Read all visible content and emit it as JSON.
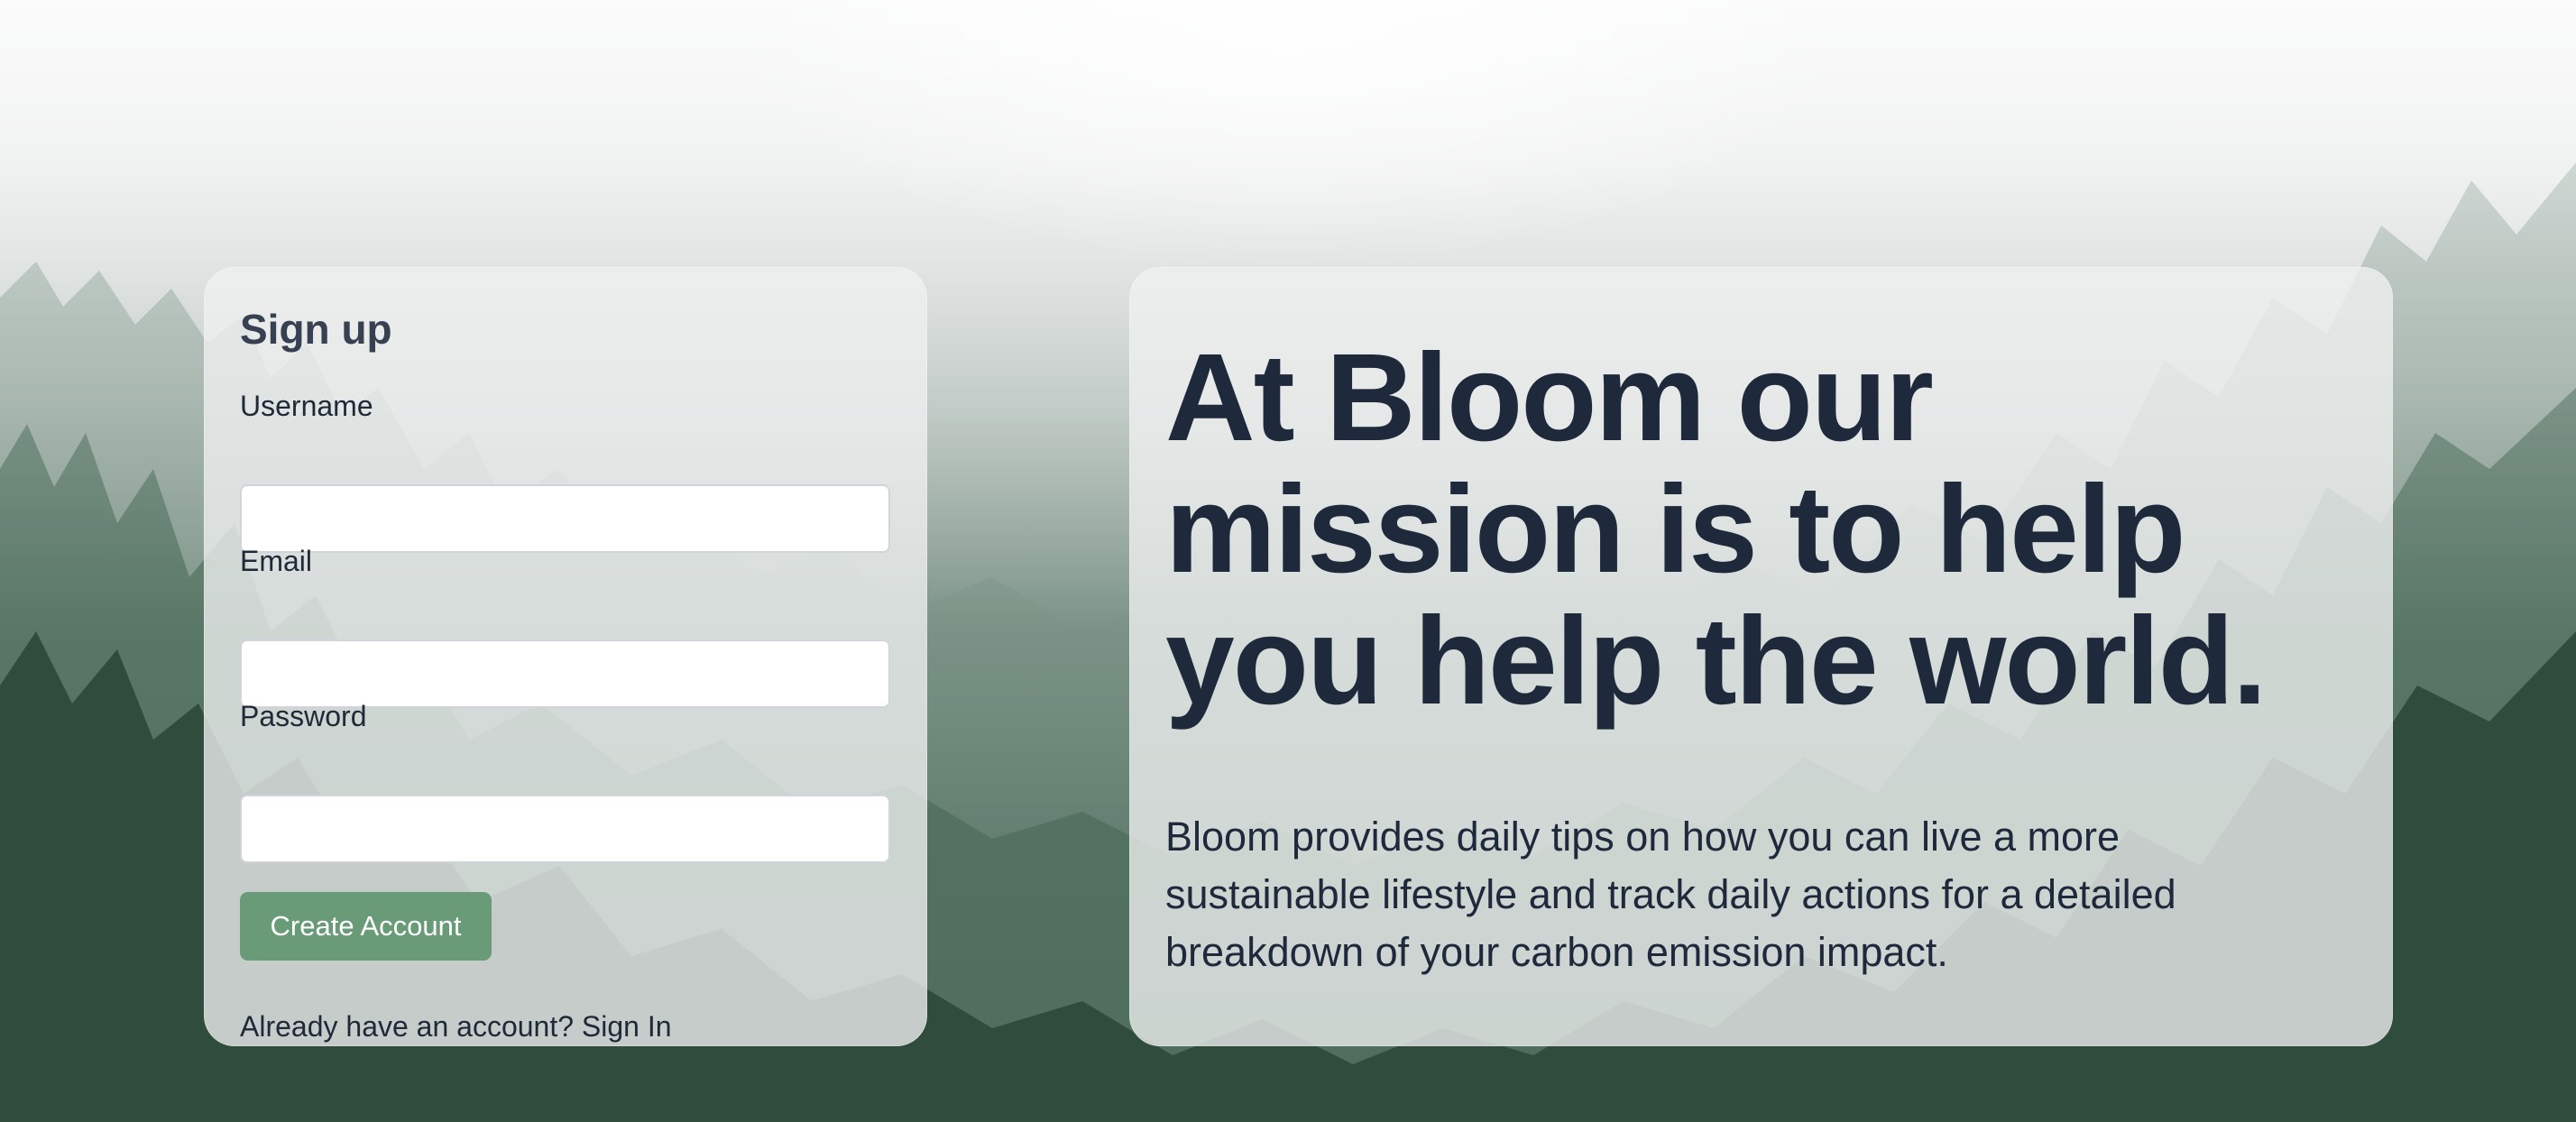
{
  "signup": {
    "title": "Sign up",
    "username_label": "Username",
    "username_value": "",
    "email_label": "Email",
    "email_value": "",
    "password_label": "Password",
    "password_value": "",
    "create_button_label": "Create Account",
    "have_account_text": "Already have an account?",
    "sign_in_label": "Sign In"
  },
  "mission": {
    "heading": "At Bloom our mission is to help you help the world.",
    "description": "Bloom provides daily tips on how you can live a more sustainable lifestyle and track daily actions for a detailed breakdown of your carbon emission impact."
  },
  "colors": {
    "accent_button": "#6a9b78",
    "heading_text": "#1e293b",
    "panel_bg": "#f0f1f1"
  },
  "background": {
    "image": "misty-forest"
  }
}
